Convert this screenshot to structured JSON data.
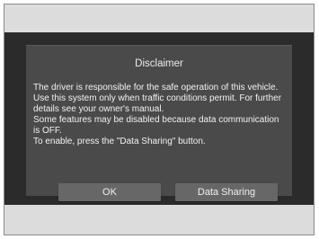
{
  "dialog": {
    "title": "Disclaimer",
    "message": "The driver is responsible for the safe operation of this vehicle. Use this system only when traffic conditions permit. For further details see your owner's manual.\nSome features may be disabled because data communication is OFF.\nTo enable, press the \"Data Sharing\" button.",
    "ok_label": "OK",
    "data_sharing_label": "Data Sharing"
  },
  "colors": {
    "screen_background": "#2b2b2b",
    "dialog_background": "#4a4a4a",
    "button_background": "#676767",
    "outer_band": "#dcdcdc"
  }
}
